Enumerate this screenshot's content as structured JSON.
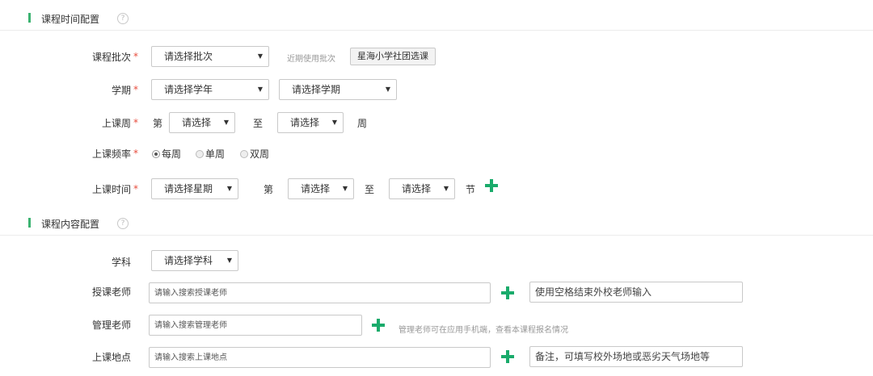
{
  "sections": {
    "time": {
      "title": "课程时间配置",
      "help": "?"
    },
    "content": {
      "title": "课程内容配置",
      "help": "?"
    }
  },
  "required_mark": "*",
  "arrow": "▼",
  "batch": {
    "label": "课程批次",
    "select": "请选择批次",
    "recent_label": "近期使用批次",
    "recent_button": "星海小学社团选课"
  },
  "term": {
    "label": "学期",
    "year_select": "请选择学年",
    "term_select": "请选择学期"
  },
  "week": {
    "label": "上课周",
    "prefix": "第",
    "from_select": "请选择",
    "to": "至",
    "to_select": "请选择",
    "suffix": "周"
  },
  "frequency": {
    "label": "上课频率",
    "options": [
      {
        "label": "每周",
        "checked": true
      },
      {
        "label": "单周",
        "checked": false
      },
      {
        "label": "双周",
        "checked": false
      }
    ]
  },
  "time": {
    "label": "上课时间",
    "weekday_select": "请选择星期",
    "prefix": "第",
    "from_select": "请选择",
    "to": "至",
    "to_select": "请选择",
    "suffix": "节"
  },
  "subject": {
    "label": "学科",
    "select": "请选择学科"
  },
  "teacher": {
    "label": "授课老师",
    "placeholder": "请输入搜索授课老师",
    "external_placeholder": "使用空格结束外校老师输入"
  },
  "manager": {
    "label": "管理老师",
    "placeholder": "请输入搜索管理老师",
    "hint": "管理老师可在应用手机端，查看本课程报名情况"
  },
  "location": {
    "label": "上课地点",
    "placeholder": "请输入搜索上课地点",
    "note_placeholder": "备注，可填写校外场地或恶劣天气场地等"
  }
}
